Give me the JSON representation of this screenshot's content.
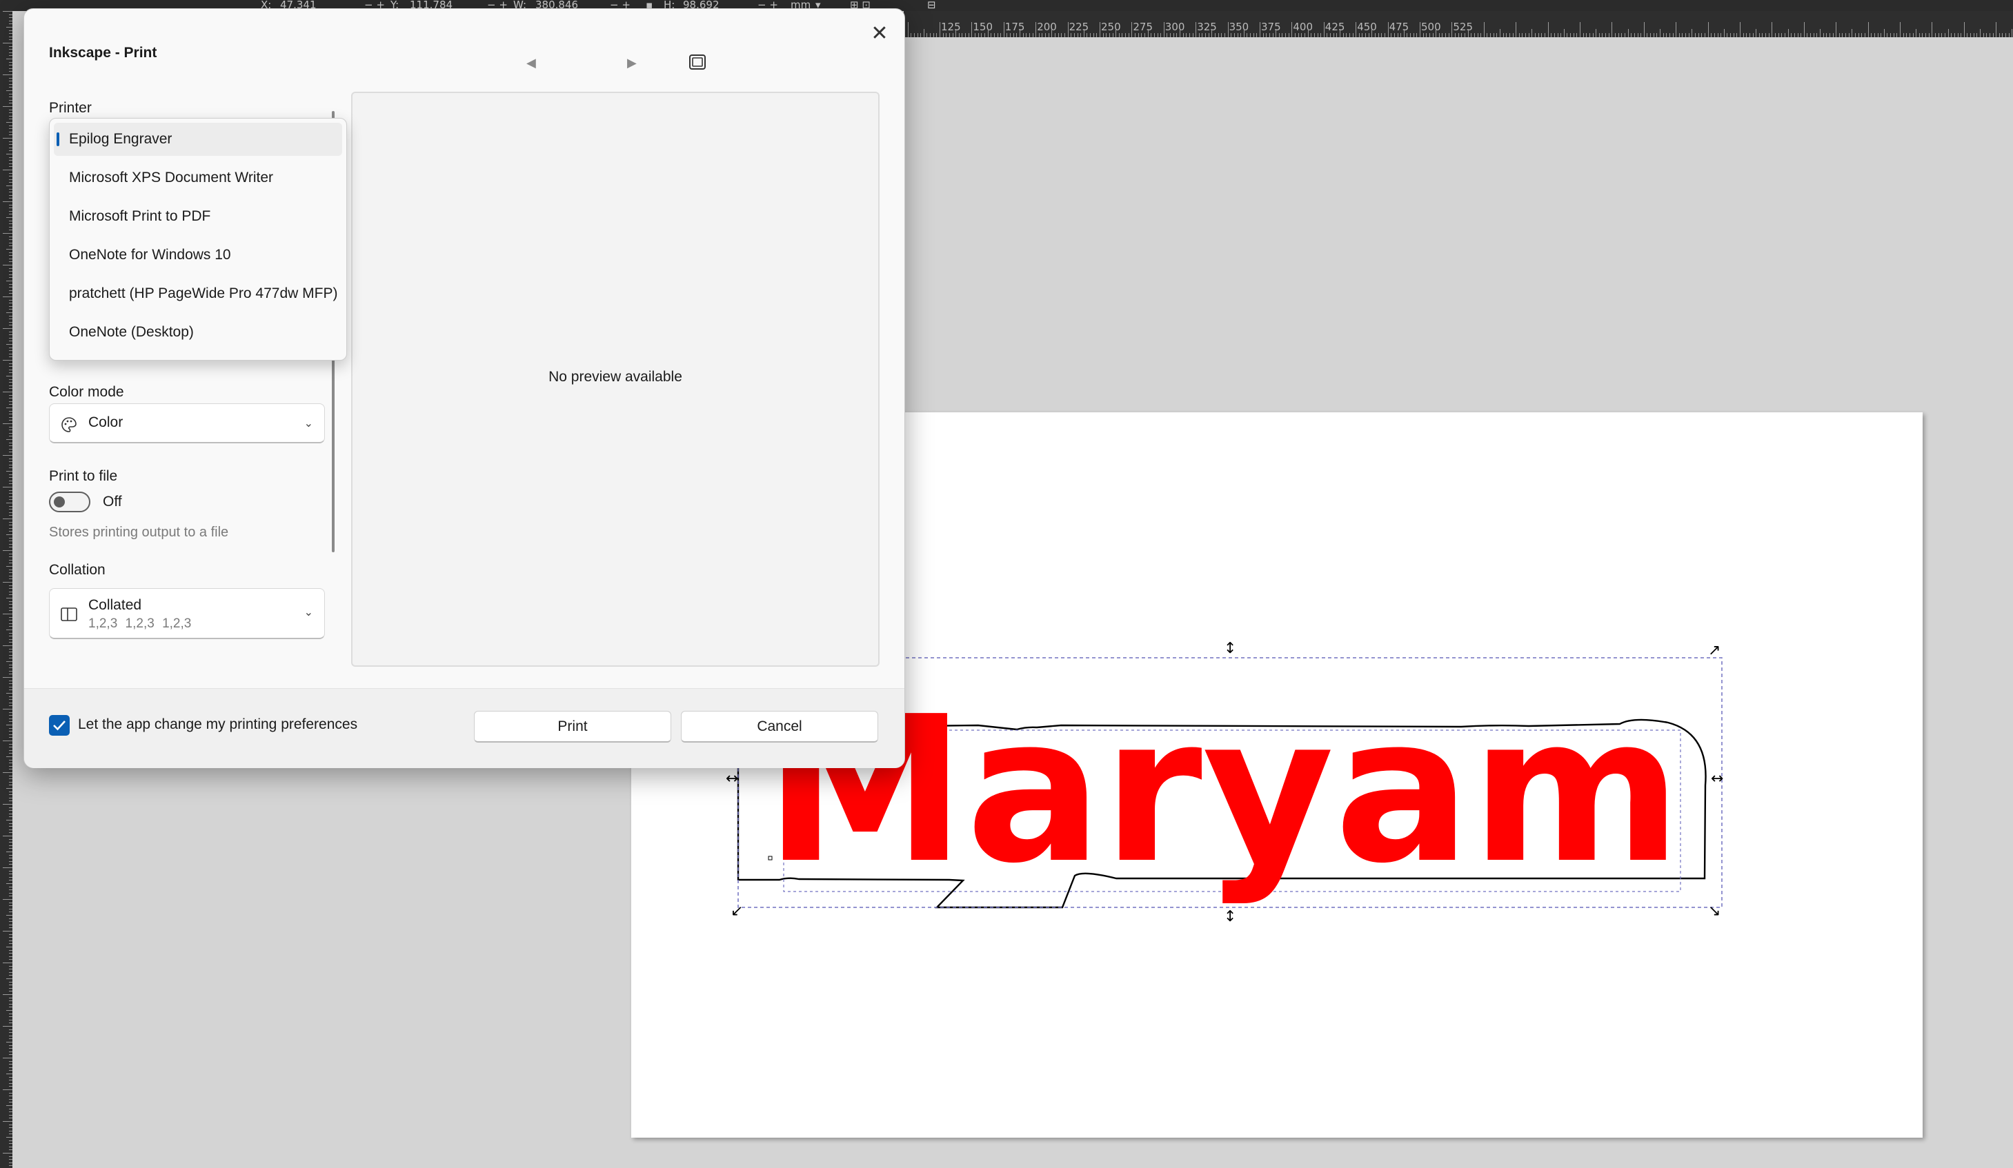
{
  "inkscape": {
    "toolbar": {
      "x_label": "X:",
      "x_value": "47.341",
      "y_label": "Y:",
      "y_value": "111.784",
      "w_label": "W:",
      "w_value": "380.846",
      "h_label": "H:",
      "h_value": "98.692",
      "unit": "mm"
    },
    "ruler_labels": [
      "125",
      "150",
      "175",
      "200",
      "225",
      "250",
      "275",
      "300",
      "325",
      "350",
      "375",
      "400",
      "425",
      "450",
      "475",
      "500",
      "525"
    ],
    "artwork_text": "Maryam",
    "colors": {
      "text_fill": "#ff0000",
      "outline": "#000000",
      "selection": "#5a5ab4"
    }
  },
  "dialog": {
    "title": "Inkscape - Print",
    "close_icon": "close-icon",
    "printer": {
      "label": "Printer",
      "options": [
        "Epilog Engraver",
        "Microsoft XPS Document Writer",
        "Microsoft Print to PDF",
        "OneNote for Windows 10",
        "pratchett (HP PageWide Pro 477dw MFP)",
        "OneNote (Desktop)"
      ],
      "selected_index": 0
    },
    "color_mode": {
      "label": "Color mode",
      "value": "Color",
      "icon": "palette-icon"
    },
    "print_to_file": {
      "label": "Print to file",
      "state": "Off",
      "description": "Stores printing output to a file"
    },
    "collation": {
      "label": "Collation",
      "value": "Collated",
      "detail": "1,2,3 1,2,3 1,2,3",
      "icon": "collate-icon"
    },
    "preview_text": "No preview available",
    "checkbox_label": "Let the app change my printing preferences",
    "checkbox_checked": true,
    "print_button": "Print",
    "cancel_button": "Cancel",
    "accent_color": "#0a5fb4"
  }
}
